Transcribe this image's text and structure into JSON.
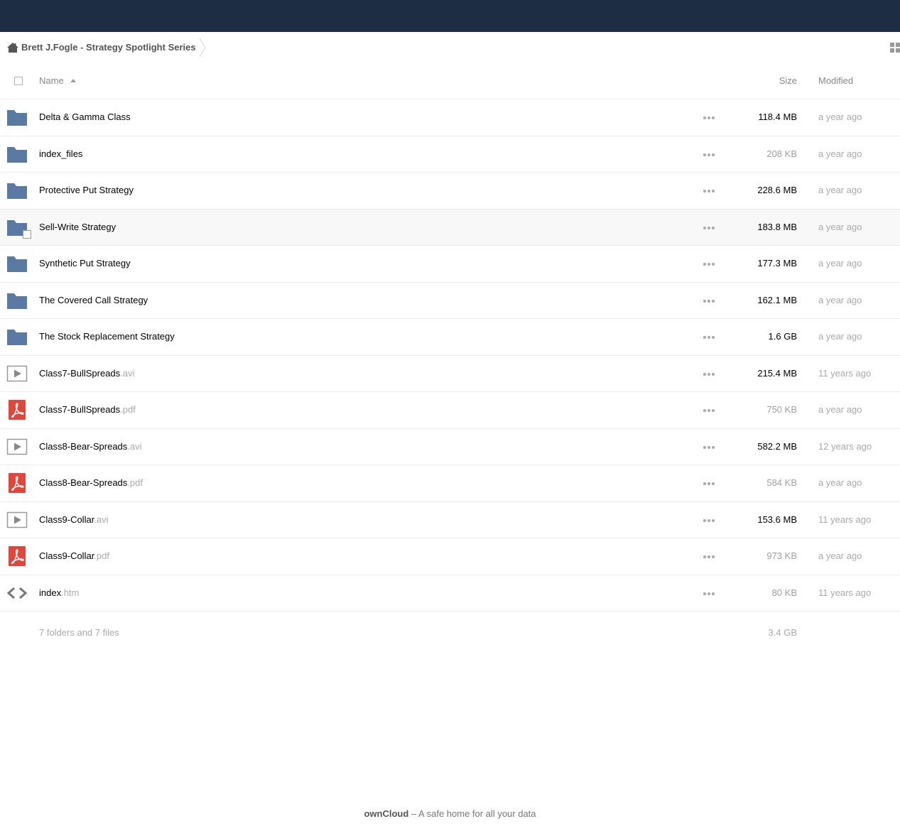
{
  "breadcrumb": {
    "home_icon": "home-icon",
    "current": "Brett J.Fogle - Strategy Spotlight Series"
  },
  "header": {
    "name": "Name",
    "size": "Size",
    "modified": "Modified"
  },
  "colors": {
    "topbar": "#1d2d44",
    "folder": "#5b7aa3",
    "pdf": "#e2463a"
  },
  "files": [
    {
      "name": "Delta & Gamma Class",
      "ext": "",
      "type": "folder",
      "size": "118.4 MB",
      "modified": "a year ago"
    },
    {
      "name": "index_files",
      "ext": "",
      "type": "folder",
      "size": "208 KB",
      "modified": "a year ago"
    },
    {
      "name": "Protective Put Strategy",
      "ext": "",
      "type": "folder",
      "size": "228.6 MB",
      "modified": "a year ago"
    },
    {
      "name": "Sell-Write Strategy",
      "ext": "",
      "type": "folder",
      "size": "183.8 MB",
      "modified": "a year ago"
    },
    {
      "name": "Synthetic Put Strategy",
      "ext": "",
      "type": "folder",
      "size": "177.3 MB",
      "modified": "a year ago"
    },
    {
      "name": "The Covered Call Strategy",
      "ext": "",
      "type": "folder",
      "size": "162.1 MB",
      "modified": "a year ago"
    },
    {
      "name": "The Stock Replacement Strategy",
      "ext": "",
      "type": "folder",
      "size": "1.6 GB",
      "modified": "a year ago"
    },
    {
      "name": "Class7-BullSpreads",
      "ext": ".avi",
      "type": "video",
      "size": "215.4 MB",
      "modified": "11 years ago"
    },
    {
      "name": "Class7-BullSpreads",
      "ext": ".pdf",
      "type": "pdf",
      "size": "750 KB",
      "modified": "a year ago"
    },
    {
      "name": "Class8-Bear-Spreads",
      "ext": ".avi",
      "type": "video",
      "size": "582.2 MB",
      "modified": "12 years ago"
    },
    {
      "name": "Class8-Bear-Spreads",
      "ext": ".pdf",
      "type": "pdf",
      "size": "584 KB",
      "modified": "a year ago"
    },
    {
      "name": "Class9-Collar",
      "ext": ".avi",
      "type": "video",
      "size": "153.6 MB",
      "modified": "11 years ago"
    },
    {
      "name": "Class9-Collar",
      "ext": ".pdf",
      "type": "pdf",
      "size": "973 KB",
      "modified": "a year ago"
    },
    {
      "name": "index",
      "ext": ".htm",
      "type": "code",
      "size": "80 KB",
      "modified": "11 years ago"
    }
  ],
  "summary": {
    "text": "7 folders and 7 files",
    "size": "3.4 GB"
  },
  "footer": {
    "brand": "ownCloud",
    "tagline": " – A safe home for all your data"
  }
}
